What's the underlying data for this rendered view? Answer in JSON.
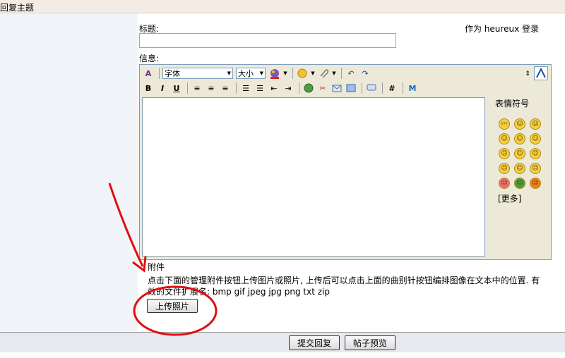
{
  "header": {
    "title": "回复主题"
  },
  "form": {
    "subject_label": "标题:",
    "message_label": "信息:",
    "login_info": "作为 heureux 登录"
  },
  "toolbar": {
    "font_select": "字体",
    "size_select": "大小",
    "bold": "B",
    "italic": "I",
    "underline": "U",
    "hash": "#"
  },
  "smilies": {
    "title": "表情符号",
    "more": "[更多]",
    "items": [
      "???",
      "",
      "",
      "",
      "",
      "",
      "",
      "",
      "",
      "",
      "",
      "",
      "",
      "",
      ""
    ]
  },
  "attachments": {
    "title": "附件",
    "description": "点击下面的管理附件按钮上传图片或照片, 上传后可以点击上面的曲别针按钮编排图像在文本中的位置. 有效的文件扩展名: bmp gif jpeg jpg png txt zip",
    "upload_button": "上传照片"
  },
  "footer": {
    "submit_button": "提交回复",
    "preview_button": "帖子预览"
  },
  "colors": {
    "annotation": "#e01010",
    "panel": "#f1f4f8",
    "titlebar": "#f4ece4"
  }
}
